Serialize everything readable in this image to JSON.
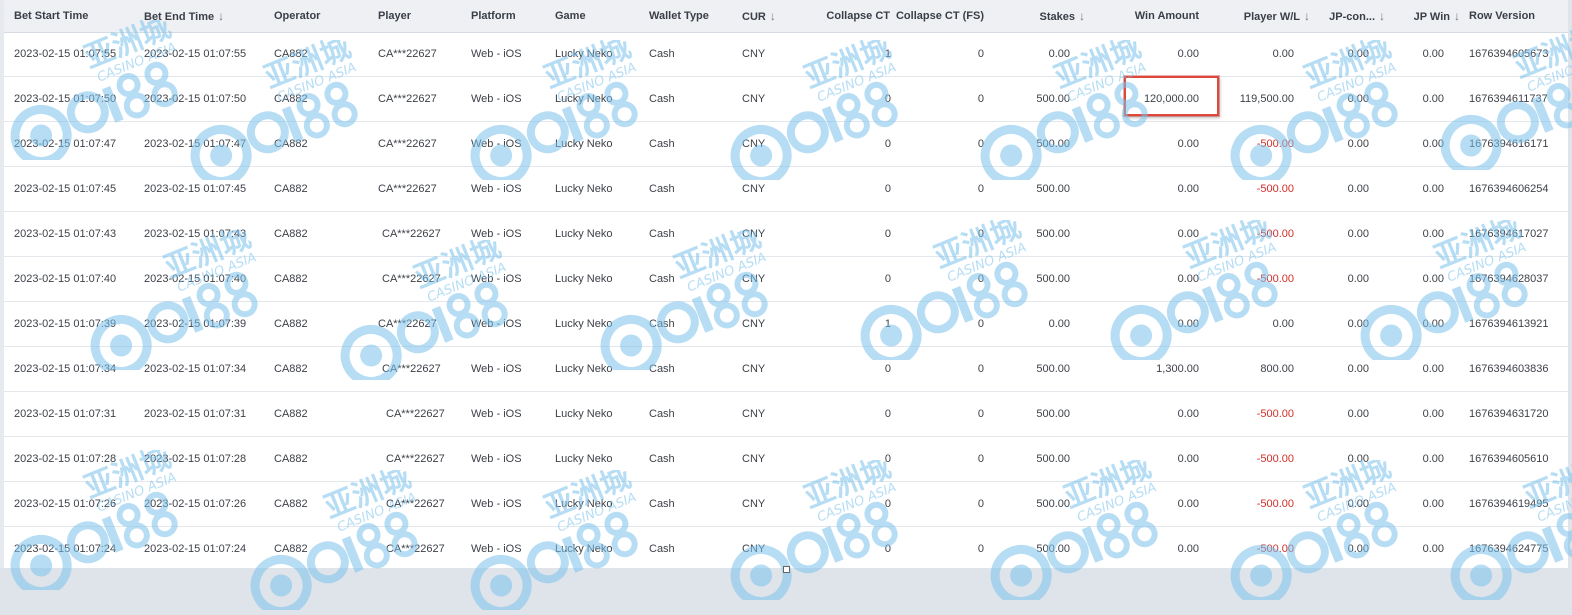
{
  "columns": [
    {
      "key": "start",
      "label": "Bet Start Time",
      "sort": false
    },
    {
      "key": "end",
      "label": "Bet End Time",
      "sort": true
    },
    {
      "key": "operator",
      "label": "Operator",
      "sort": false
    },
    {
      "key": "player",
      "label": "Player",
      "sort": false
    },
    {
      "key": "platform",
      "label": "Platform",
      "sort": false
    },
    {
      "key": "game",
      "label": "Game",
      "sort": false
    },
    {
      "key": "wallet",
      "label": "Wallet Type",
      "sort": false
    },
    {
      "key": "cur",
      "label": "CUR",
      "sort": true
    },
    {
      "key": "collapse",
      "label": "Collapse CT",
      "sort": false
    },
    {
      "key": "collapse_fs",
      "label": "Collapse CT (FS)",
      "sort": false
    },
    {
      "key": "stakes",
      "label": "Stakes",
      "sort": true
    },
    {
      "key": "win",
      "label": "Win Amount",
      "sort": false
    },
    {
      "key": "wl",
      "label": "Player W/L",
      "sort": true
    },
    {
      "key": "jpc",
      "label": "JP-con...",
      "sort": true
    },
    {
      "key": "jpwin",
      "label": "JP Win",
      "sort": true
    },
    {
      "key": "rowver",
      "label": "Row Version",
      "sort": false
    }
  ],
  "rows": [
    {
      "start": "2023-02-15 01:07:55",
      "end": "2023-02-15 01:07:55",
      "operator": "CA882",
      "player": "CA***22627",
      "platform": "Web - iOS",
      "game": "Lucky Neko",
      "wallet": "Cash",
      "cur": "CNY",
      "collapse": "1",
      "collapse_fs": "0",
      "stakes": "0.00",
      "win": "0.00",
      "wl": "0.00",
      "jpc": "0.00",
      "jpwin": "0.00",
      "rowver": "1676394605673"
    },
    {
      "start": "2023-02-15 01:07:50",
      "end": "2023-02-15 01:07:50",
      "operator": "CA882",
      "player": "CA***22627",
      "platform": "Web - iOS",
      "game": "Lucky Neko",
      "wallet": "Cash",
      "cur": "CNY",
      "collapse": "0",
      "collapse_fs": "0",
      "stakes": "500.00",
      "win": "120,000.00",
      "wl": "119,500.00",
      "jpc": "0.00",
      "jpwin": "0.00",
      "rowver": "1676394611737"
    },
    {
      "start": "2023-02-15 01:07:47",
      "end": "2023-02-15 01:07:47",
      "operator": "CA882",
      "player": "CA***22627",
      "platform": "Web - iOS",
      "game": "Lucky Neko",
      "wallet": "Cash",
      "cur": "CNY",
      "collapse": "0",
      "collapse_fs": "0",
      "stakes": "500.00",
      "win": "0.00",
      "wl": "-500.00",
      "jpc": "0.00",
      "jpwin": "0.00",
      "rowver": "1676394616171"
    },
    {
      "start": "2023-02-15 01:07:45",
      "end": "2023-02-15 01:07:45",
      "operator": "CA882",
      "player": "CA***22627",
      "platform": "Web - iOS",
      "game": "Lucky Neko",
      "wallet": "Cash",
      "cur": "CNY",
      "collapse": "0",
      "collapse_fs": "0",
      "stakes": "500.00",
      "win": "0.00",
      "wl": "-500.00",
      "jpc": "0.00",
      "jpwin": "0.00",
      "rowver": "1676394606254"
    },
    {
      "start": "2023-02-15 01:07:43",
      "end": "2023-02-15 01:07:43",
      "operator": "CA882",
      "player": "CA***22627",
      "platform": "Web - iOS",
      "game": "Lucky Neko",
      "wallet": "Cash",
      "cur": "CNY",
      "collapse": "0",
      "collapse_fs": "0",
      "stakes": "500.00",
      "win": "0.00",
      "wl": "-500.00",
      "jpc": "0.00",
      "jpwin": "0.00",
      "rowver": "1676394617027"
    },
    {
      "start": "2023-02-15 01:07:40",
      "end": "2023-02-15 01:07:40",
      "operator": "CA882",
      "player": "CA***22627",
      "platform": "Web - iOS",
      "game": "Lucky Neko",
      "wallet": "Cash",
      "cur": "CNY",
      "collapse": "0",
      "collapse_fs": "0",
      "stakes": "500.00",
      "win": "0.00",
      "wl": "-500.00",
      "jpc": "0.00",
      "jpwin": "0.00",
      "rowver": "1676394628037"
    },
    {
      "start": "2023-02-15 01:07:39",
      "end": "2023-02-15 01:07:39",
      "operator": "CA882",
      "player": "CA***22627",
      "platform": "Web - iOS",
      "game": "Lucky Neko",
      "wallet": "Cash",
      "cur": "CNY",
      "collapse": "1",
      "collapse_fs": "0",
      "stakes": "0.00",
      "win": "0.00",
      "wl": "0.00",
      "jpc": "0.00",
      "jpwin": "0.00",
      "rowver": "1676394613921"
    },
    {
      "start": "2023-02-15 01:07:34",
      "end": "2023-02-15 01:07:34",
      "operator": "CA882",
      "player": "CA***22627",
      "platform": "Web - iOS",
      "game": "Lucky Neko",
      "wallet": "Cash",
      "cur": "CNY",
      "collapse": "0",
      "collapse_fs": "0",
      "stakes": "500.00",
      "win": "1,300.00",
      "wl": "800.00",
      "jpc": "0.00",
      "jpwin": "0.00",
      "rowver": "1676394603836"
    },
    {
      "start": "2023-02-15 01:07:31",
      "end": "2023-02-15 01:07:31",
      "operator": "CA882",
      "player": "CA***22627",
      "platform": "Web - iOS",
      "game": "Lucky Neko",
      "wallet": "Cash",
      "cur": "CNY",
      "collapse": "0",
      "collapse_fs": "0",
      "stakes": "500.00",
      "win": "0.00",
      "wl": "-500.00",
      "jpc": "0.00",
      "jpwin": "0.00",
      "rowver": "1676394631720"
    },
    {
      "start": "2023-02-15 01:07:28",
      "end": "2023-02-15 01:07:28",
      "operator": "CA882",
      "player": "CA***22627",
      "platform": "Web - iOS",
      "game": "Lucky Neko",
      "wallet": "Cash",
      "cur": "CNY",
      "collapse": "0",
      "collapse_fs": "0",
      "stakes": "500.00",
      "win": "0.00",
      "wl": "-500.00",
      "jpc": "0.00",
      "jpwin": "0.00",
      "rowver": "1676394605610"
    },
    {
      "start": "2023-02-15 01:07:26",
      "end": "2023-02-15 01:07:26",
      "operator": "CA882",
      "player": "CA***22627",
      "platform": "Web - iOS",
      "game": "Lucky Neko",
      "wallet": "Cash",
      "cur": "CNY",
      "collapse": "0",
      "collapse_fs": "0",
      "stakes": "500.00",
      "win": "0.00",
      "wl": "-500.00",
      "jpc": "0.00",
      "jpwin": "0.00",
      "rowver": "1676394619495"
    },
    {
      "start": "2023-02-15 01:07:24",
      "end": "2023-02-15 01:07:24",
      "operator": "CA882",
      "player": "CA***22627",
      "platform": "Web - iOS",
      "game": "Lucky Neko",
      "wallet": "Cash",
      "cur": "CNY",
      "collapse": "0",
      "collapse_fs": "0",
      "stakes": "500.00",
      "win": "0.00",
      "wl": "-500.00",
      "jpc": "0.00",
      "jpwin": "0.00",
      "rowver": "1676394624775"
    }
  ],
  "watermark": {
    "cn": "亚洲城",
    "en": "CASINO ASIA",
    "logo": "ca88",
    "color": "#7cc3ec"
  },
  "colors": {
    "negative": "#d0302a",
    "highlight": "#e0483a",
    "header_bg": "#eef0f4"
  },
  "sort_icon": "arrow-down-icon"
}
